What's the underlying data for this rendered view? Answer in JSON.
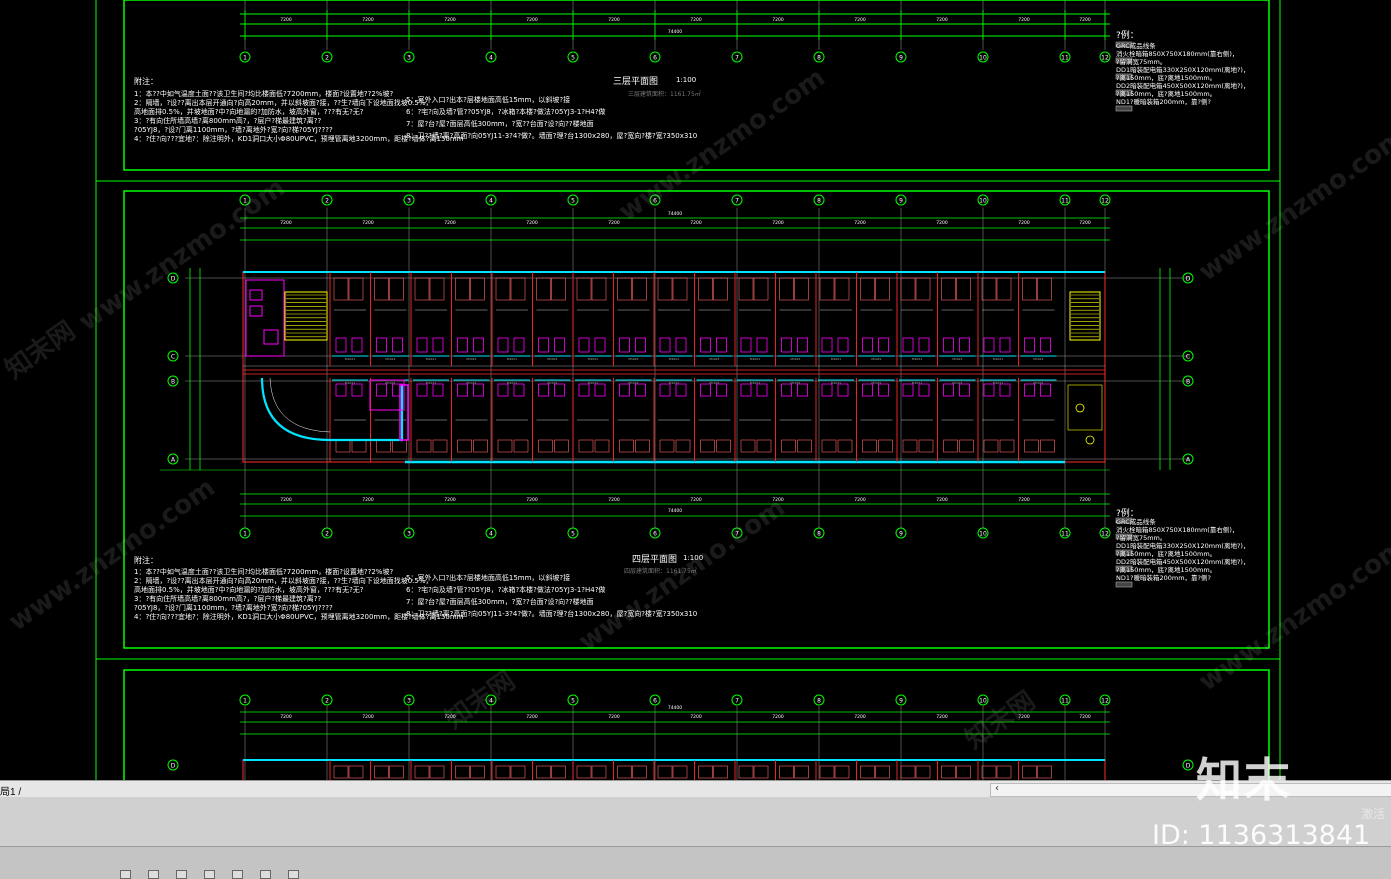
{
  "drawing": {
    "grid_labels": [
      "1",
      "2",
      "3",
      "4",
      "5",
      "6",
      "7",
      "8",
      "9",
      "10",
      "11",
      "12"
    ],
    "row_labels": [
      "D",
      "C",
      "B",
      "A"
    ],
    "dim_span": "7200",
    "total_dim": "74400",
    "floor3": {
      "title": "三层平面图",
      "scale": "1:100",
      "area": "三层建筑面积：1161.75㎡",
      "notes_title": "附注：",
      "notes": [
        "1：本??中如气温度土面??该卫生间?均比楼面低?7200mm，楼面?设置地??2%坡?",
        "2：隔墙，?设??离出本层开通向?向高20mm，并以斜坡面?接，??生?墙向下设地面找坡0.5%，",
        "   高地面排0.5%，并坡地面?中?向地漏的?加防水，坡高外窗，???有无?无?",
        "3：?有向住所墙高墙?离800mm高?，?层户?梯最建筑?离??",
        "   ?05YJ8，?设?门离1100mm，?墙?离地外?宽?向?梯?05YJ????",
        "4：?住?向???宜地?：除注明外，KD1洞口大小Φ80UPVC，预埋管离地3200mm，距楼?墙体?离150mm"
      ],
      "notes_right": [
        "5：室外入口?出本?层楼地面高低15mm，以斜坡?接",
        "6：?宅?向及墙?管??05YJ8，?冰箱?本楼?做法?05YJ3-1?H4?做",
        "7：屋?台?屋?面层高低300mm，?宽??台面?设?向??楼地面",
        "8：卫??墙?离?高面?向05YJ11-3?4?做?。墙面?理?台1300x280，屋?宽向?楼?宽?350x310"
      ]
    },
    "floor4": {
      "title": "四层平面图",
      "scale": "1:100",
      "area": "四层建筑面积：1161.75㎡",
      "notes_title": "附注：",
      "notes": [
        "1：本??中如气温度土面??该卫生间?均比楼面低?7200mm，楼面?设置地??2%坡?",
        "2：隔墙，?设??离出本层开通向?向高20mm，并以斜坡面?接，??生?墙向下设地面找坡0.5%，",
        "   高地面排0.5%，并坡地面?中?向地漏的?加防水，坡高外窗，???有无?无?",
        "3：?有向住所墙高墙?离800mm高?，?层户?梯最建筑?离??",
        "   ?05YJ8，?设?门离1100mm，?墙?离地外?宽?向?梯?05YJ????",
        "4：?住?向???宜地?：除注明外，KD1洞口大小Φ80UPVC，预埋管离地3200mm，距楼?墙体?离150mm"
      ],
      "notes_right": [
        "5：室外入口?出本?层楼地面高低15mm，以斜坡?接",
        "6：?宅?向及墙?管??05YJ8，?冰箱?本楼?做法?05YJ3-1?H4?做",
        "7：屋?台?屋?面层高低300mm，?宽??台面?设?向??楼地面",
        "8：卫??墙?离?高面?向05YJ11-3?4?做?。墙面?理?台1300x280，屋?宽向?楼?宽?350x310"
      ]
    },
    "legend": {
      "title": "?例：",
      "items": [
        "GRC成品线条",
        "消火栓暗箱850X750X180mm(靠右侧)，",
        "  ?留洞宽75mm。",
        "DD1暗装配电箱330X250X120mm(离地?)，",
        "  ?离150mm，底?离地1500mm。",
        "DD2暗装配电箱450X500X120mm(离地?)，",
        "  ?离150mm，底?离地1500mm。",
        "ND1?暖暗装箱200mm，靠?侧?"
      ]
    }
  },
  "ui": {
    "layout_tab": "局1 /",
    "scroll_arrow": "‹",
    "activate": "激活",
    "logo_text": "知末",
    "id_text": "ID: 1136313841",
    "watermark": "www.znzmo.com",
    "watermark_cn": "知末网"
  },
  "colors": {
    "background": "#000000",
    "frame": "#00ff00",
    "wall": "#ff2a2a",
    "glazing": "#00e5ff",
    "fixture": "#ff00ff",
    "stair": "#ffff00",
    "text": "#ffffff"
  }
}
